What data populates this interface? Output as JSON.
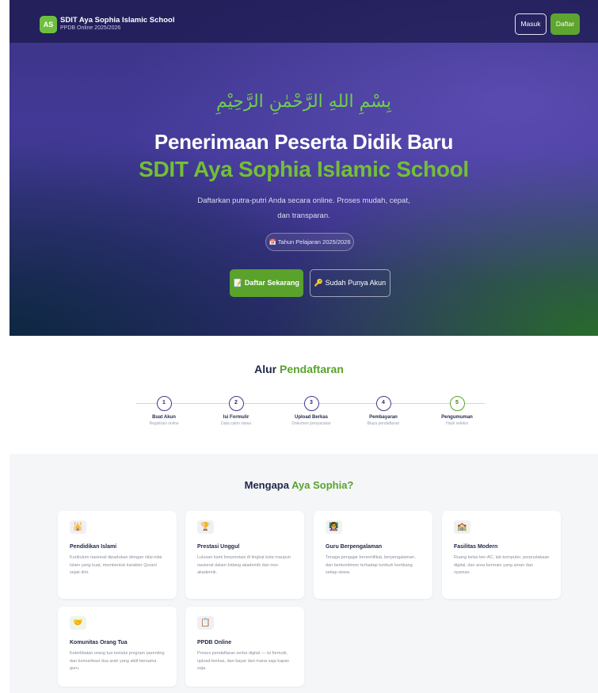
{
  "header": {
    "logo_text": "AS",
    "school_name": "SDIT Aya Sophia Islamic School",
    "subtitle": "PPDB Online 2025/2026",
    "login_label": "Masuk",
    "register_label": "Daftar"
  },
  "hero": {
    "bismillah": "بِسْمِ اللهِ الرَّحْمٰنِ الرَّحِيْمِ",
    "title": "Penerimaan Peserta Didik Baru",
    "school": "SDIT Aya Sophia Islamic School",
    "description": "Daftarkan putra-putri Anda secara online. Proses mudah, cepat, dan transparan.",
    "year_badge": "📅 Tahun Pelajaran 2025/2026",
    "cta_primary": "📝 Daftar Sekarang",
    "cta_secondary": "🔑 Sudah Punya Akun"
  },
  "flow": {
    "title_prefix": "Alur",
    "title_accent": "Pendaftaran",
    "steps": [
      {
        "num": "1",
        "label": "Buat Akun",
        "sub": "Registrasi online"
      },
      {
        "num": "2",
        "label": "Isi Formulir",
        "sub": "Data calon siswa"
      },
      {
        "num": "3",
        "label": "Upload Berkas",
        "sub": "Dokumen persyaratan"
      },
      {
        "num": "4",
        "label": "Pembayaran",
        "sub": "Biaya pendaftaran"
      },
      {
        "num": "5",
        "label": "Pengumuman",
        "sub": "Hasil seleksi"
      }
    ]
  },
  "why": {
    "title_prefix": "Mengapa",
    "title_accent": "Aya Sophia?",
    "cards": [
      {
        "icon": "🕌",
        "title": "Pendidikan Islami",
        "desc": "Kurikulum nasional dipadukan dengan nilai-nilai Islam yang kuat, membentuk karakter Qurani sejak dini."
      },
      {
        "icon": "🏆",
        "title": "Prestasi Unggul",
        "desc": "Lulusan kami berprestasi di tingkat kota maupun nasional dalam bidang akademik dan non-akademik."
      },
      {
        "icon": "👩‍🏫",
        "title": "Guru Berpengalaman",
        "desc": "Tenaga pengajar bersertifikat, berpengalaman, dan berkomitmen terhadap tumbuh kembang setiap siswa."
      },
      {
        "icon": "🏫",
        "title": "Fasilitas Modern",
        "desc": "Ruang kelas ber-AC, lab komputer, perpustakaan digital, dan area bermain yang aman dan nyaman."
      },
      {
        "icon": "🤝",
        "title": "Komunitas Orang Tua",
        "desc": "Keterlibatan orang tua melalui program parenting dan komunikasi dua arah yang aktif bersama guru."
      },
      {
        "icon": "📋",
        "title": "PPDB Online",
        "desc": "Proses pendaftaran serba digital — isi formulir, upload berkas, dan bayar dari mana saja kapan saja."
      }
    ]
  }
}
